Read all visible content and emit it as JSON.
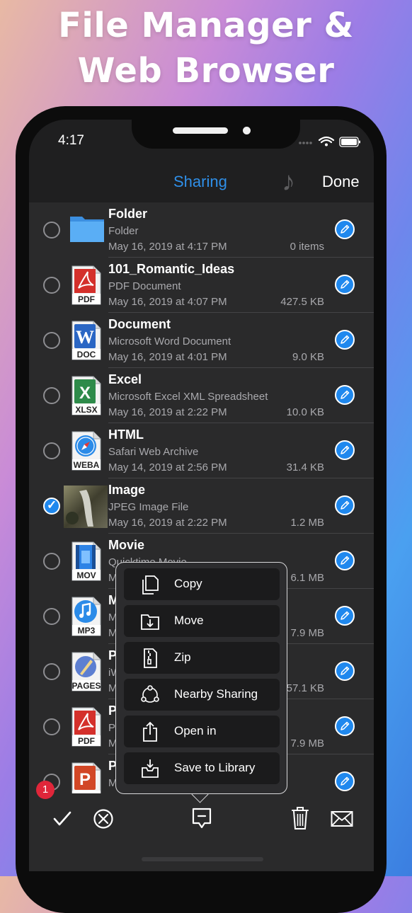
{
  "headline": {
    "line1": "File Manager &",
    "line2": "Web Browser"
  },
  "status": {
    "time": "4:17"
  },
  "nav": {
    "title": "Sharing",
    "done": "Done"
  },
  "files": [
    {
      "name": "Folder",
      "type": "Folder",
      "date": "May 16, 2019 at 4:17 PM",
      "size": "0 items",
      "icon": "folder-icon",
      "selected": false
    },
    {
      "name": "101_Romantic_Ideas",
      "type": "PDF Document",
      "date": "May 16, 2019 at 4:07 PM",
      "size": "427.5 KB",
      "icon": "pdf-icon",
      "selected": false
    },
    {
      "name": "Document",
      "type": "Microsoft Word Document",
      "date": "May 16, 2019 at 4:01 PM",
      "size": "9.0 KB",
      "icon": "doc-icon",
      "selected": false
    },
    {
      "name": "Excel",
      "type": "Microsoft Excel XML Spreadsheet",
      "date": "May 16, 2019 at 2:22 PM",
      "size": "10.0 KB",
      "icon": "xlsx-icon",
      "selected": false
    },
    {
      "name": "HTML",
      "type": "Safari Web Archive",
      "date": "May 14, 2019 at 2:56 PM",
      "size": "31.4 KB",
      "icon": "webarchive-icon",
      "selected": false
    },
    {
      "name": "Image",
      "type": "JPEG Image File",
      "date": "May 16, 2019 at 2:22 PM",
      "size": "1.2 MB",
      "icon": "image-thumbnail",
      "selected": true
    },
    {
      "name": "Movie",
      "type": "Quicktime Movie",
      "date": "Ma",
      "size": "6.1 MB",
      "icon": "mov-icon",
      "selected": false
    },
    {
      "name": "Music",
      "type": "M",
      "date": "Ma",
      "size": "7.9 MB",
      "icon": "mp3-icon",
      "selected": false
    },
    {
      "name": "Pa",
      "type": "iW",
      "date": "Ma",
      "size": "57.1 KB",
      "icon": "pages-icon",
      "selected": false
    },
    {
      "name": "PD",
      "type": "PD",
      "date": "Ma",
      "size": "7.9 MB",
      "icon": "pdf-icon",
      "selected": false
    },
    {
      "name": "Pr",
      "type": "M",
      "date": "",
      "size": "",
      "icon": "ppt-icon",
      "selected": false
    }
  ],
  "file_icon_labels": {
    "pdf": "PDF",
    "doc": "DOC",
    "xlsx": "XLSX",
    "weba": "WEBA",
    "mov": "MOV",
    "mp3": "MP3",
    "pages": "PAGES"
  },
  "popup_menu": [
    {
      "label": "Copy",
      "icon": "copy-icon"
    },
    {
      "label": "Move",
      "icon": "move-folder-icon"
    },
    {
      "label": "Zip",
      "icon": "zip-icon"
    },
    {
      "label": "Nearby Sharing",
      "icon": "nearby-sharing-icon"
    },
    {
      "label": "Open in",
      "icon": "share-icon"
    },
    {
      "label": "Save to Library",
      "icon": "save-library-icon"
    }
  ],
  "toolbar": {
    "badge_count": "1"
  },
  "colors": {
    "accent": "#1f88ee",
    "background": "#1f1f20",
    "row": "#2a2a2b"
  }
}
